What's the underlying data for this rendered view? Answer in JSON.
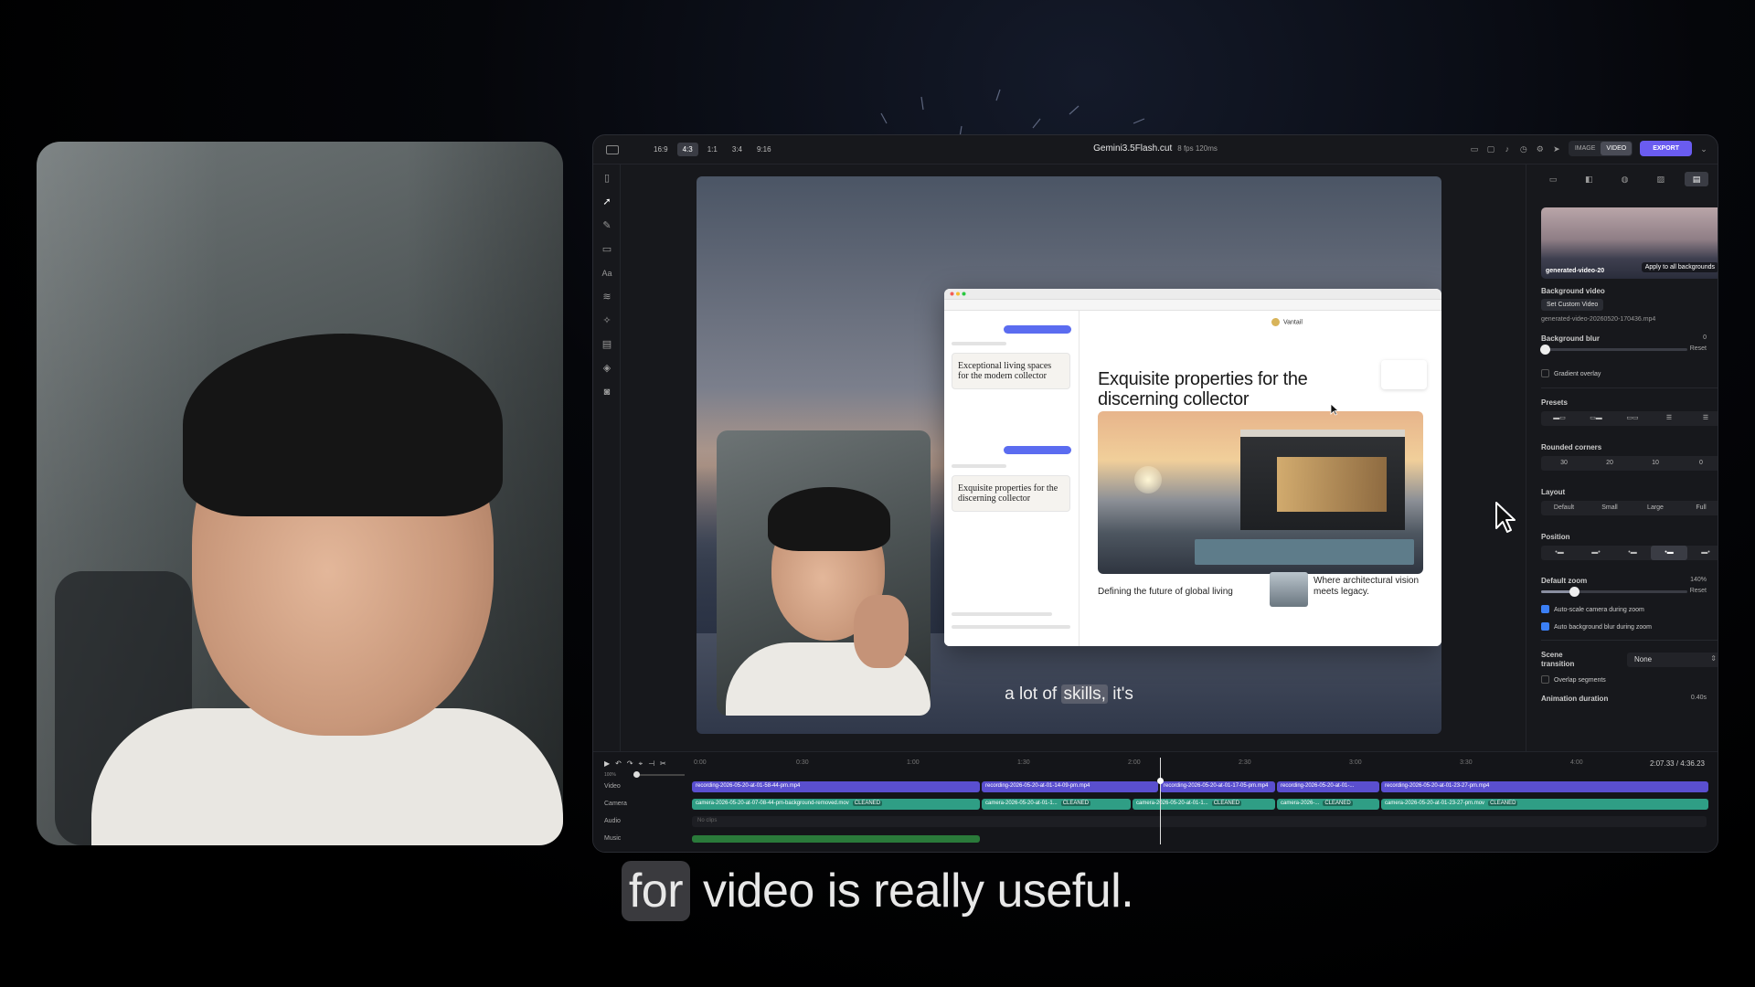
{
  "editor": {
    "aspect_ratios": [
      "16:9",
      "4:3",
      "1:1",
      "3:4",
      "9:16"
    ],
    "active_ratio": "4:3",
    "project_title": "Gemini3.5Flash.cut",
    "project_meta": "8 fps  120ms",
    "mode_tabs": [
      "IMAGE",
      "VIDEO"
    ],
    "active_mode": "VIDEO",
    "export_label": "EXPORT"
  },
  "preview": {
    "site_logo": "Vantail",
    "site_headline": "Exquisite properties for the discerning collector",
    "site_footer_left": "Defining the future of global living",
    "site_footer_right": "Where architectural vision meets legacy.",
    "chat_card_1": "Exceptional living spaces for the modern collector",
    "chat_card_2": "Exquisite properties for the discerning collector",
    "caption_before": "a lot of ",
    "caption_highlight": "skills,",
    "caption_after": " it's"
  },
  "panel": {
    "thumb_filename": "generated-video-20",
    "apply_all": "Apply to all backgrounds",
    "background_video_label": "Background video",
    "set_custom_video": "Set Custom Video",
    "video_filename": "generated-video-20260520-170436.mp4",
    "background_blur_label": "Background blur",
    "background_blur_value": "0",
    "background_blur_level": 0.0,
    "reset": "Reset",
    "gradient_overlay": "Gradient overlay",
    "gradient_overlay_checked": false,
    "presets_label": "Presets",
    "rounded_corners_label": "Rounded corners",
    "rounded_corners": [
      "30",
      "20",
      "10",
      "0"
    ],
    "layout_label": "Layout",
    "layout_options": [
      "Default",
      "Small",
      "Large",
      "Full"
    ],
    "position_label": "Position",
    "active_position_index": 3,
    "default_zoom_label": "Default zoom",
    "default_zoom_value": "140%",
    "default_zoom_level": 0.2,
    "auto_scale": "Auto-scale camera during zoom",
    "auto_scale_checked": true,
    "auto_blur": "Auto background blur during zoom",
    "auto_blur_checked": true,
    "scene_transition_label": "Scene transition",
    "scene_transition_value": "None",
    "overlap_segments": "Overlap segments",
    "overlap_segments_checked": false,
    "animation_duration_label": "Animation duration",
    "animation_duration_value": "0.40s"
  },
  "timeline": {
    "ruler_ticks": [
      "0:00",
      "0:30",
      "1:00",
      "1:30",
      "2:00",
      "2:30",
      "3:00",
      "3:30",
      "4:00"
    ],
    "current_time": "2:07.33 / 4:36.23",
    "zoom_label": "100%",
    "track_labels": [
      "Video",
      "Camera",
      "Audio",
      "Music"
    ],
    "video_clips": [
      "recording-2026-05-20-at-01-58-44-pm.mp4",
      "recording-2026-05-20-at-01-14-09-pm.mp4",
      "recording-2026-05-20-at-01-17-05-pm.mp4",
      "recording-2026-05-20-at-01-...",
      "recording-2026-05-20-at-01-23-27-pm.mp4"
    ],
    "camera_clips": [
      "camera-2026-05-20-at-07-08-44-pm-background-removed.mov",
      "camera-2026-05-20-at-01-1...",
      "camera-2026-05-20-at-01-1...",
      "camera-2026-...",
      "camera-2026-05-20-at-01-23-27-pm.mov"
    ],
    "cleaned_badge": "CLEANED",
    "audio_empty": "No clips"
  },
  "caption": {
    "highlight": "for",
    "rest": " video is really useful."
  },
  "colors": {
    "accent": "#6a5cf0",
    "video_clip": "#5a4fcf",
    "camera_clip": "#2f9e85",
    "music_clip": "#2a7a3a",
    "checkbox_on": "#3b7ff5"
  }
}
